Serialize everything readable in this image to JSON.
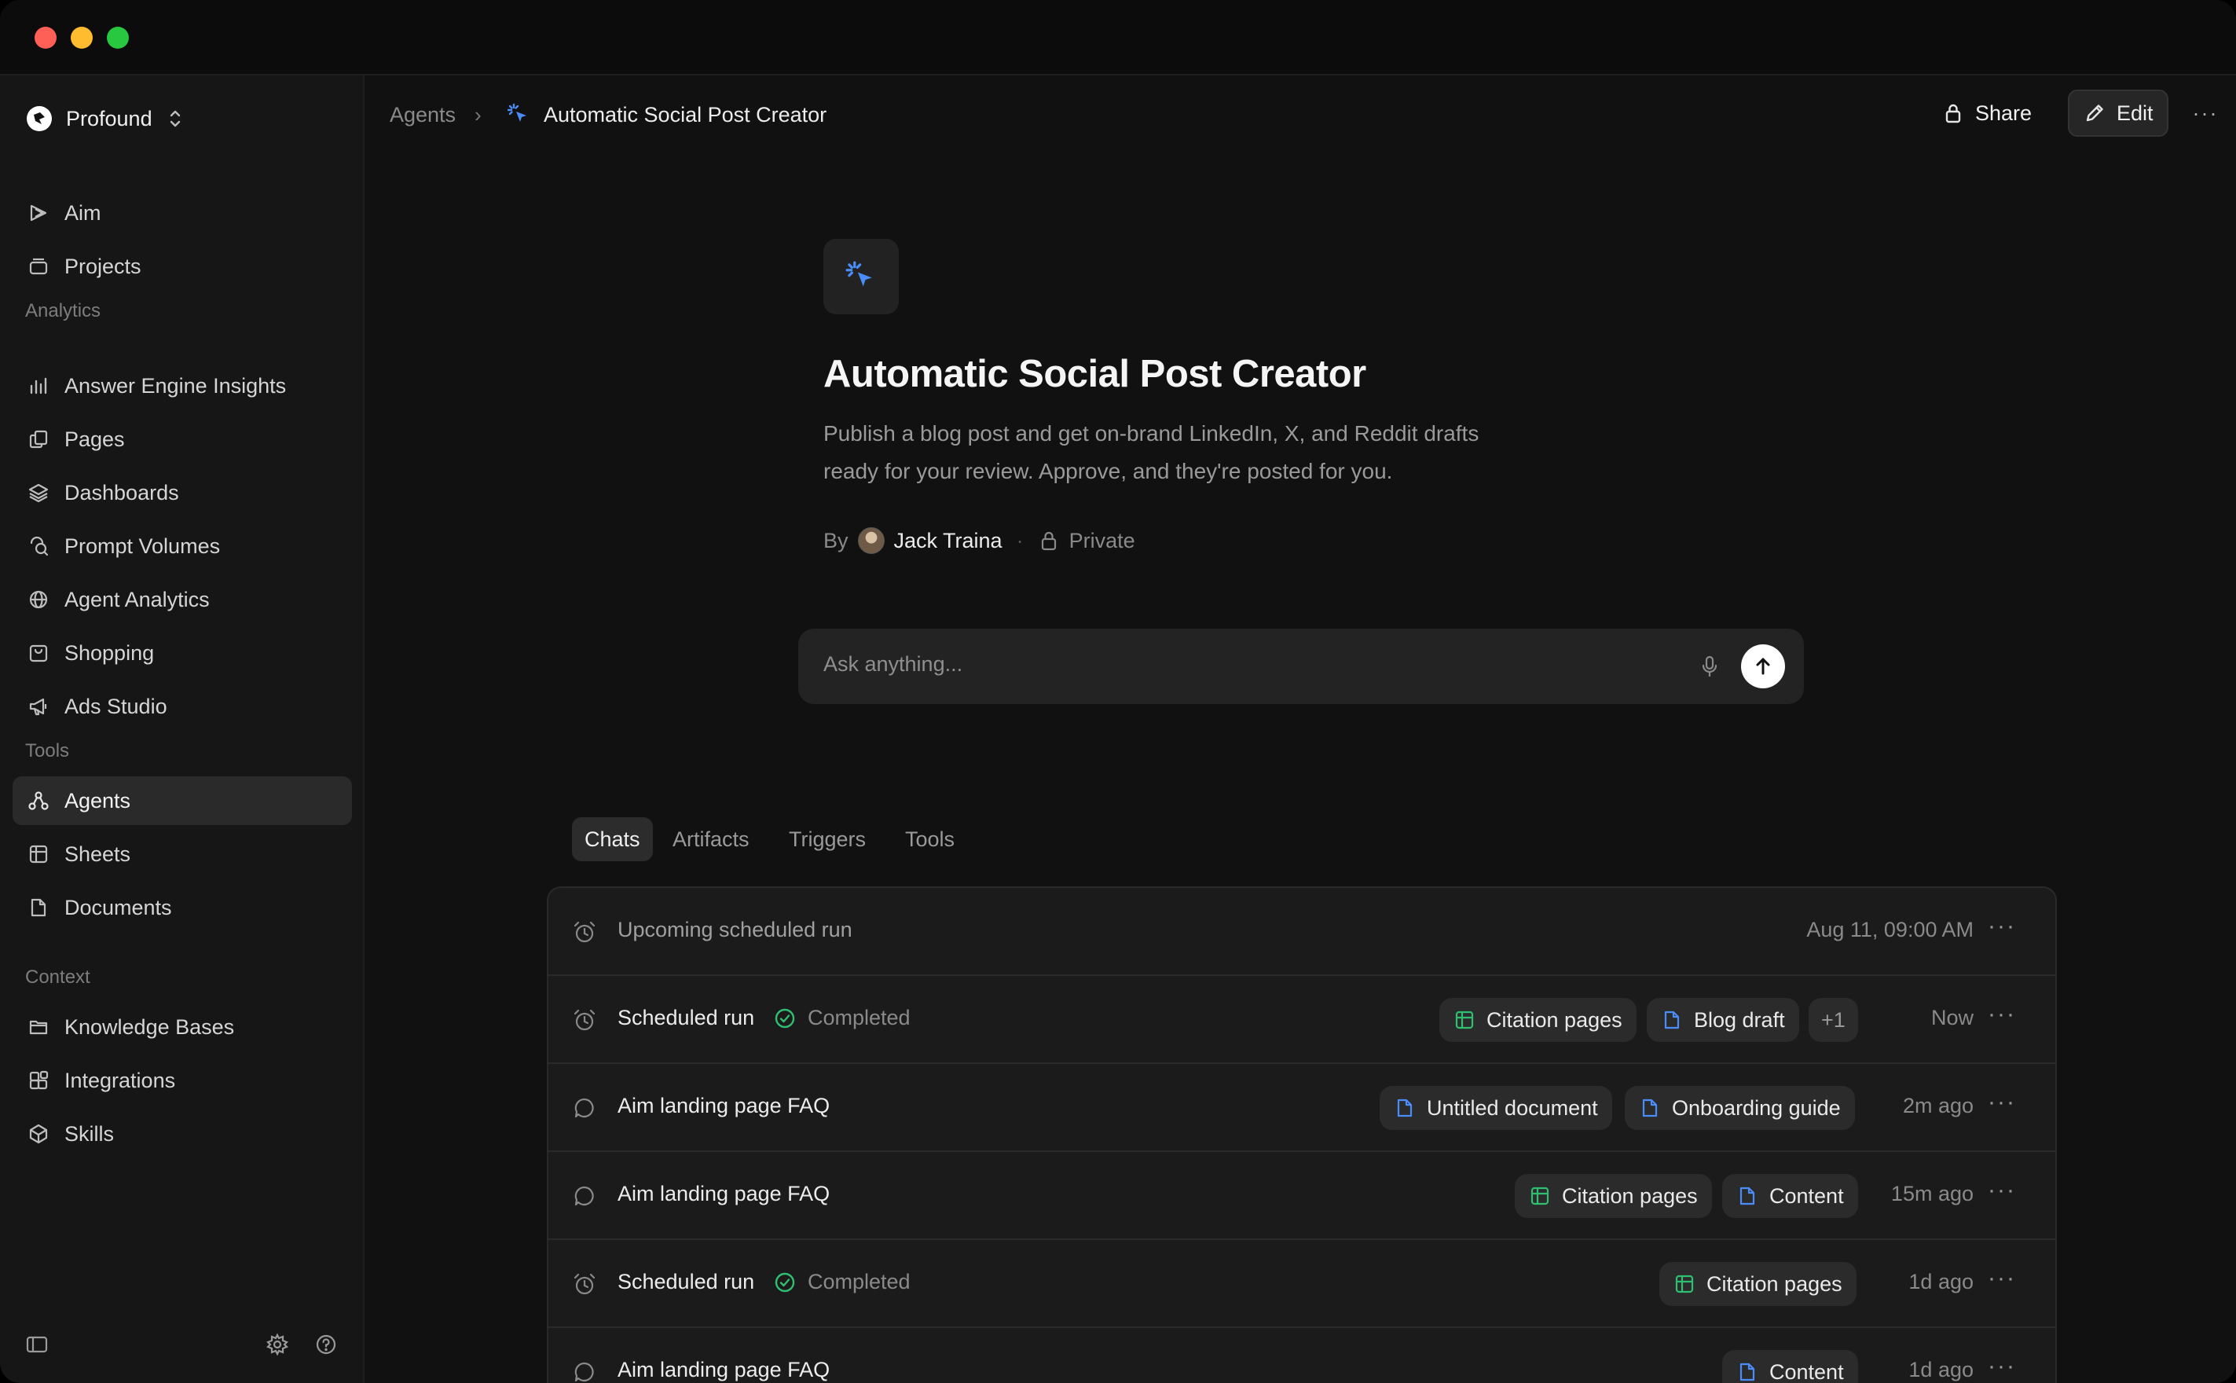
{
  "workspace": {
    "name": "Profound"
  },
  "sidebar": {
    "top_items": [
      {
        "label": "Aim",
        "icon": "aim-icon"
      },
      {
        "label": "Projects",
        "icon": "projects-icon"
      }
    ],
    "sections": [
      {
        "label": "Analytics",
        "items": [
          {
            "label": "Answer Engine Insights",
            "icon": "bar-chart-icon"
          },
          {
            "label": "Pages",
            "icon": "pages-icon"
          },
          {
            "label": "Dashboards",
            "icon": "layers-icon"
          },
          {
            "label": "Prompt Volumes",
            "icon": "search-icon"
          },
          {
            "label": "Agent Analytics",
            "icon": "globe-icon"
          },
          {
            "label": "Shopping",
            "icon": "shopping-bag-icon"
          },
          {
            "label": "Ads Studio",
            "icon": "megaphone-icon"
          }
        ]
      },
      {
        "label": "Tools",
        "items": [
          {
            "label": "Agents",
            "icon": "agents-icon",
            "active": true
          },
          {
            "label": "Sheets",
            "icon": "table-icon"
          },
          {
            "label": "Documents",
            "icon": "document-icon"
          }
        ]
      },
      {
        "label": "Context",
        "items": [
          {
            "label": "Knowledge Bases",
            "icon": "folder-icon"
          },
          {
            "label": "Integrations",
            "icon": "integrations-icon"
          },
          {
            "label": "Skills",
            "icon": "cube-icon"
          }
        ]
      }
    ]
  },
  "breadcrumb": {
    "root": "Agents",
    "separator": "›",
    "current": "Automatic Social Post Creator"
  },
  "header_actions": {
    "share": "Share",
    "edit": "Edit",
    "more": "···"
  },
  "agent": {
    "title": "Automatic Social Post Creator",
    "description_line1": "Publish a blog post and get on-brand LinkedIn, X, and Reddit drafts",
    "description_line2": "ready for your review. Approve, and they're posted for you.",
    "by_label": "By",
    "author": "Jack Traina",
    "visibility": "Private"
  },
  "ask": {
    "placeholder": "Ask anything..."
  },
  "tabs": [
    "Chats",
    "Artifacts",
    "Triggers",
    "Tools"
  ],
  "active_tab": "Chats",
  "rows": [
    {
      "title": "Upcoming scheduled run",
      "status": "",
      "chips": [],
      "time": "Aug 11, 09:00 AM"
    },
    {
      "title": "Scheduled run",
      "status": "Completed",
      "chips": [
        {
          "label": "Citation pages",
          "type": "sheet"
        },
        {
          "label": "Blog draft",
          "type": "doc"
        },
        {
          "label": "+1",
          "type": "count"
        }
      ],
      "time": "Now"
    },
    {
      "title": "Aim landing page FAQ",
      "status": "",
      "chips": [
        {
          "label": "Untitled document",
          "type": "doc"
        },
        {
          "label": "Onboarding guide",
          "type": "doc"
        }
      ],
      "time": "2m ago"
    },
    {
      "title": "Aim landing page FAQ",
      "status": "",
      "chips": [
        {
          "label": "Citation pages",
          "type": "sheet"
        },
        {
          "label": "Content",
          "type": "doc"
        }
      ],
      "time": "15m ago"
    },
    {
      "title": "Scheduled run",
      "status": "Completed",
      "chips": [
        {
          "label": "Citation pages",
          "type": "sheet"
        }
      ],
      "time": "1d ago"
    },
    {
      "title": "Aim landing page FAQ",
      "status": "",
      "chips": [
        {
          "label": "Content",
          "type": "doc"
        }
      ],
      "time": "1d ago"
    }
  ],
  "row_more": "···",
  "colors": {
    "accent_blue": "#4a8df8",
    "sheet_green": "#2fbf71",
    "status_green": "#2fbf71",
    "background": "#111111"
  }
}
